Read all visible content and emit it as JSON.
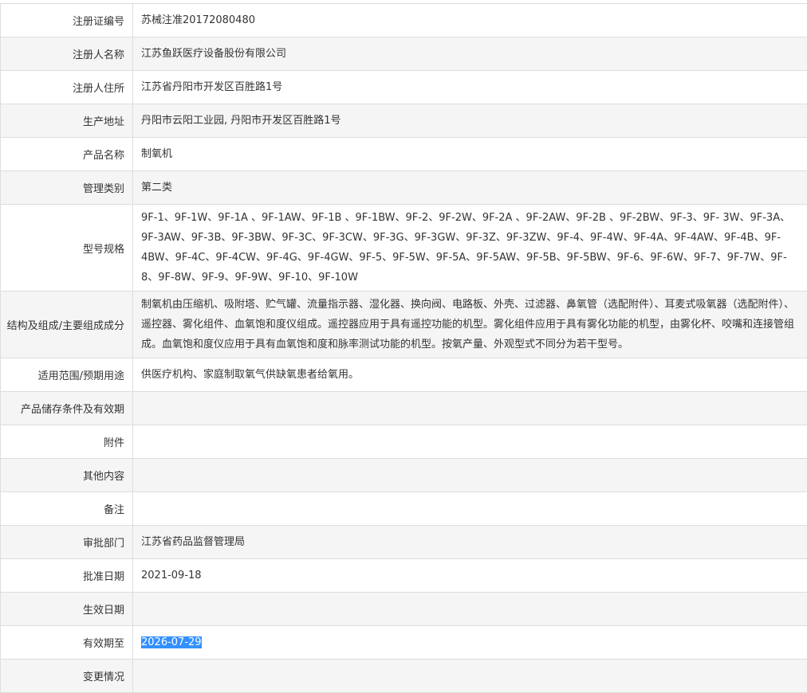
{
  "rows": [
    {
      "label": "注册证编号",
      "value": "苏械注准20172080480"
    },
    {
      "label": "注册人名称",
      "value": "江苏鱼跃医疗设备股份有限公司"
    },
    {
      "label": "注册人住所",
      "value": "江苏省丹阳市开发区百胜路1号"
    },
    {
      "label": "生产地址",
      "value": "丹阳市云阳工业园, 丹阳市开发区百胜路1号"
    },
    {
      "label": "产品名称",
      "value": "制氧机"
    },
    {
      "label": "管理类别",
      "value": "第二类"
    },
    {
      "label": "型号规格",
      "value": "9F-1、9F-1W、9F-1A 、9F-1AW、9F-1B 、9F-1BW、9F-2、9F-2W、9F-2A 、9F-2AW、9F-2B 、9F-2BW、9F-3、9F- 3W、9F-3A、9F-3AW、9F-3B、9F-3BW、9F-3C、9F-3CW、9F-3G、9F-3GW、9F-3Z、9F-3ZW、9F-4、9F-4W、9F-4A、9F-4AW、9F-4B、9F-4BW、9F-4C、9F-4CW、9F-4G、9F-4GW、9F-5、9F-5W、9F-5A、9F-5AW、9F-5B、9F-5BW、9F-6、9F-6W、9F-7、9F-7W、9F-8、9F-8W、9F-9、9F-9W、9F-10、9F-10W"
    },
    {
      "label": "结构及组成/主要组成成分",
      "value": "制氧机由压缩机、吸附塔、贮气罐、流量指示器、湿化器、换向阀、电路板、外壳、过滤器、鼻氧管（选配附件）、耳麦式吸氧器（选配附件）、遥控器、雾化组件、血氧饱和度仪组成。遥控器应用于具有遥控功能的机型。雾化组件应用于具有雾化功能的机型，由雾化杯、咬嘴和连接管组成。血氧饱和度仪应用于具有血氧饱和度和脉率测试功能的机型。按氧产量、外观型式不同分为若干型号。"
    },
    {
      "label": "适用范围/预期用途",
      "value": "供医疗机构、家庭制取氧气供缺氧患者给氧用。"
    },
    {
      "label": "产品储存条件及有效期",
      "value": ""
    },
    {
      "label": "附件",
      "value": ""
    },
    {
      "label": "其他内容",
      "value": ""
    },
    {
      "label": "备注",
      "value": ""
    },
    {
      "label": "审批部门",
      "value": "江苏省药品监督管理局"
    },
    {
      "label": "批准日期",
      "value": "2021-09-18"
    },
    {
      "label": "生效日期",
      "value": ""
    },
    {
      "label": "有效期至",
      "value": "2026-07-29"
    },
    {
      "label": "变更情况",
      "value": ""
    }
  ]
}
